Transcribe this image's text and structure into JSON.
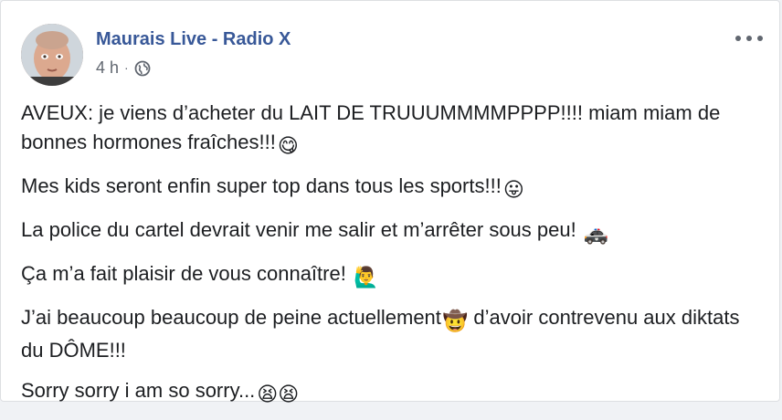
{
  "post": {
    "author": "Maurais Live - Radio X",
    "timestamp": "4 h",
    "separator": "·",
    "privacy_icon": "globe-icon",
    "more_icon": "more-options-icon",
    "paragraphs": [
      {
        "text": "AVEUX: je viens d’acheter du LAIT DE TRUUUMMMMPPPP!!!! miam miam de bonnes hormones fraîches!!!",
        "emoji": "😋"
      },
      {
        "text": "Mes kids seront enfin super top dans tous les sports!!!",
        "emoji": "😛"
      },
      {
        "text": "La police du cartel devrait venir me salir et m’arrêter sous peu! ",
        "emoji": "🚓"
      },
      {
        "text": "Ça m’a fait plaisir de vous connaître! ",
        "emoji": "🙋‍♂️"
      },
      {
        "text": "J’ai beaucoup beaucoup de peine actuellement",
        "emoji": "🤠",
        "text_after": " d’avoir contrevenu aux diktats du DÔME!!!"
      },
      {
        "text": "Sorry sorry i am so sorry...",
        "emoji": "😫😫"
      }
    ]
  },
  "colors": {
    "author_link": "#385898",
    "meta_text": "#616770",
    "body_text": "#1c1e21",
    "card_bg": "#ffffff",
    "card_border": "#dddfe2"
  }
}
